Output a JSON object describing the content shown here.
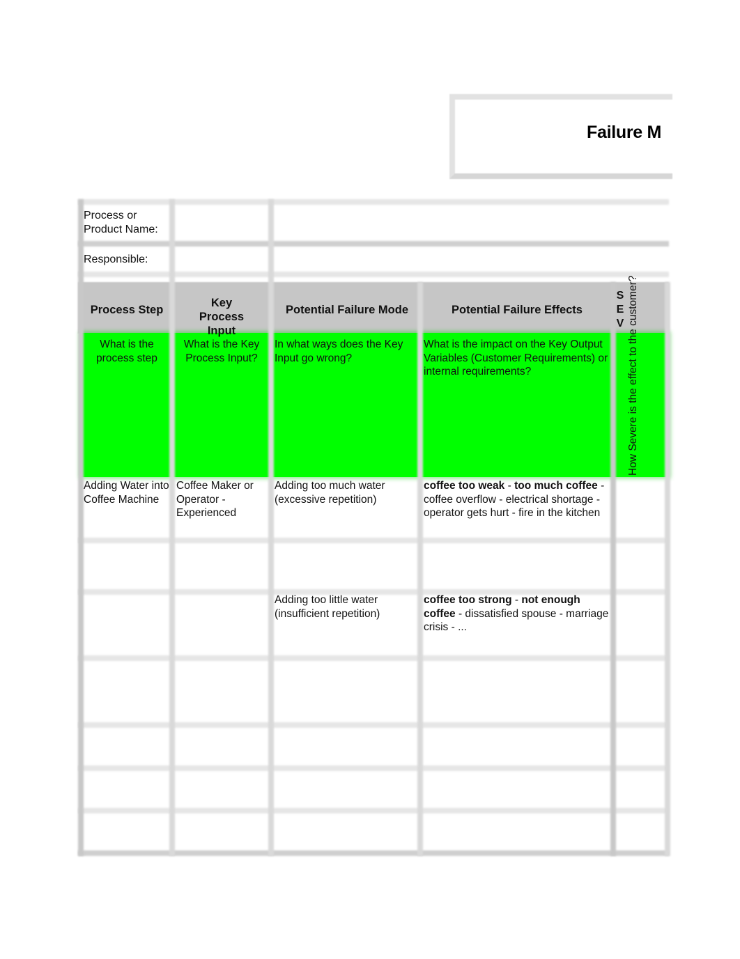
{
  "document": {
    "title": "Failure M"
  },
  "info_fields": [
    {
      "label": "Process or Product Name:",
      "value": ""
    },
    {
      "label": "Responsible:",
      "value": ""
    }
  ],
  "table": {
    "headers": {
      "process_step": "Process Step",
      "key_process_input": "Key Process Input",
      "potential_failure_mode": "Potential Failure Mode",
      "potential_failure_effects": "Potential Failure Effects",
      "sev": [
        "S",
        "E",
        "V"
      ]
    },
    "guide_row": {
      "process_step": "What is the process step",
      "key_process_input": "What is the Key Process Input?",
      "potential_failure_mode": "In what ways does the Key Input go wrong?",
      "potential_failure_effects": "What is the impact on the Key Output Variables (Customer Requirements) or internal requirements?",
      "sev": "How Severe is the effect to the customer?",
      "highlight_color": "#00ff00"
    },
    "rows": [
      {
        "process_step": "Adding Water into Coffee Machine",
        "key_process_input": "Coffee Maker or Operator - Experienced",
        "potential_failure_mode": "Adding too much water (excessive repetition)",
        "effects_bold_1": "coffee too weak",
        "effects_sep_1": " - ",
        "effects_bold_2": "too much coffee",
        "effects_rest": " - coffee overflow - electrical shortage - operator gets hurt - fire in the kitchen",
        "sev": ""
      },
      {
        "process_step": "",
        "key_process_input": "",
        "potential_failure_mode": "",
        "effects_bold_1": "",
        "effects_sep_1": "",
        "effects_bold_2": "",
        "effects_rest": "",
        "sev": ""
      },
      {
        "process_step": "",
        "key_process_input": "",
        "potential_failure_mode": "Adding too little water (insufficient repetition)",
        "effects_bold_1": "coffee too strong",
        "effects_sep_1": " - ",
        "effects_bold_2": "not enough coffee",
        "effects_rest": " - dissatisfied spouse - marriage crisis - ...",
        "sev": ""
      },
      {
        "process_step": "",
        "key_process_input": "",
        "potential_failure_mode": "",
        "effects_bold_1": "",
        "effects_sep_1": "",
        "effects_bold_2": "",
        "effects_rest": "",
        "sev": ""
      },
      {
        "process_step": "",
        "key_process_input": "",
        "potential_failure_mode": "",
        "effects_bold_1": "",
        "effects_sep_1": "",
        "effects_bold_2": "",
        "effects_rest": "",
        "sev": ""
      },
      {
        "process_step": "",
        "key_process_input": "",
        "potential_failure_mode": "",
        "effects_bold_1": "",
        "effects_sep_1": "",
        "effects_bold_2": "",
        "effects_rest": "",
        "sev": ""
      },
      {
        "process_step": "",
        "key_process_input": "",
        "potential_failure_mode": "",
        "effects_bold_1": "",
        "effects_sep_1": "",
        "effects_bold_2": "",
        "effects_rest": "",
        "sev": ""
      }
    ]
  }
}
